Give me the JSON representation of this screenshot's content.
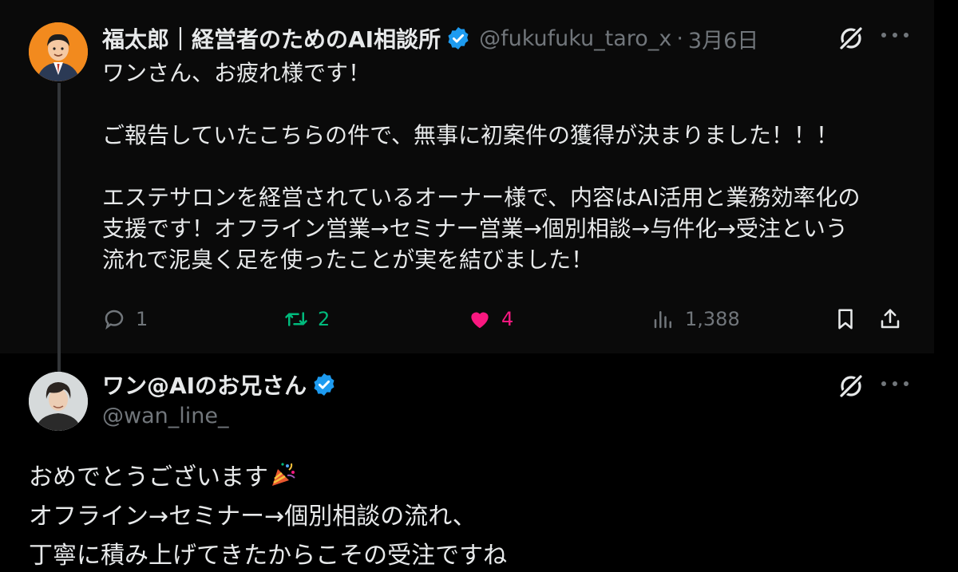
{
  "parent_tweet": {
    "display_name": "福太郎｜経営者のためのAI相談所",
    "handle": "@fukufuku_taro_x",
    "separator": "·",
    "date": "3月6日",
    "text_lines": [
      "ワンさん、お疲れ様です！",
      "",
      "ご報告していたこちらの件で、無事に初案件の獲得が決まりました！！！",
      "",
      "エステサロンを経営されているオーナー様で、内容はAI活用と業務効率化の",
      "支援です！オフライン営業→セミナー営業→個別相談→与件化→受注という",
      "流れで泥臭く足を使ったことが実を結びました！"
    ],
    "actions": {
      "reply_count": "1",
      "retweet_count": "2",
      "like_count": "4",
      "view_count": "1,388"
    }
  },
  "reply_tweet": {
    "display_name": "ワン@AIのお兄さん",
    "handle": "@wan_line_",
    "text_lines": [
      "おめでとうございます",
      "オフライン→セミナー→個別相談の流れ、",
      "丁寧に積み上げてきたからこその受注ですね"
    ]
  },
  "icons": {
    "verified": "verified-badge-icon",
    "grok": "grok-icon",
    "more": "more-icon",
    "reply": "reply-icon",
    "retweet": "retweet-icon",
    "like": "heart-icon",
    "views": "views-icon",
    "bookmark": "bookmark-icon",
    "share": "share-icon",
    "party": "party-popper-icon"
  },
  "colors": {
    "background": "#000000",
    "text": "#e7e9ea",
    "muted": "#71767b",
    "verified": "#1d9bf0",
    "retweet": "#00ba7c",
    "like": "#f91880"
  }
}
